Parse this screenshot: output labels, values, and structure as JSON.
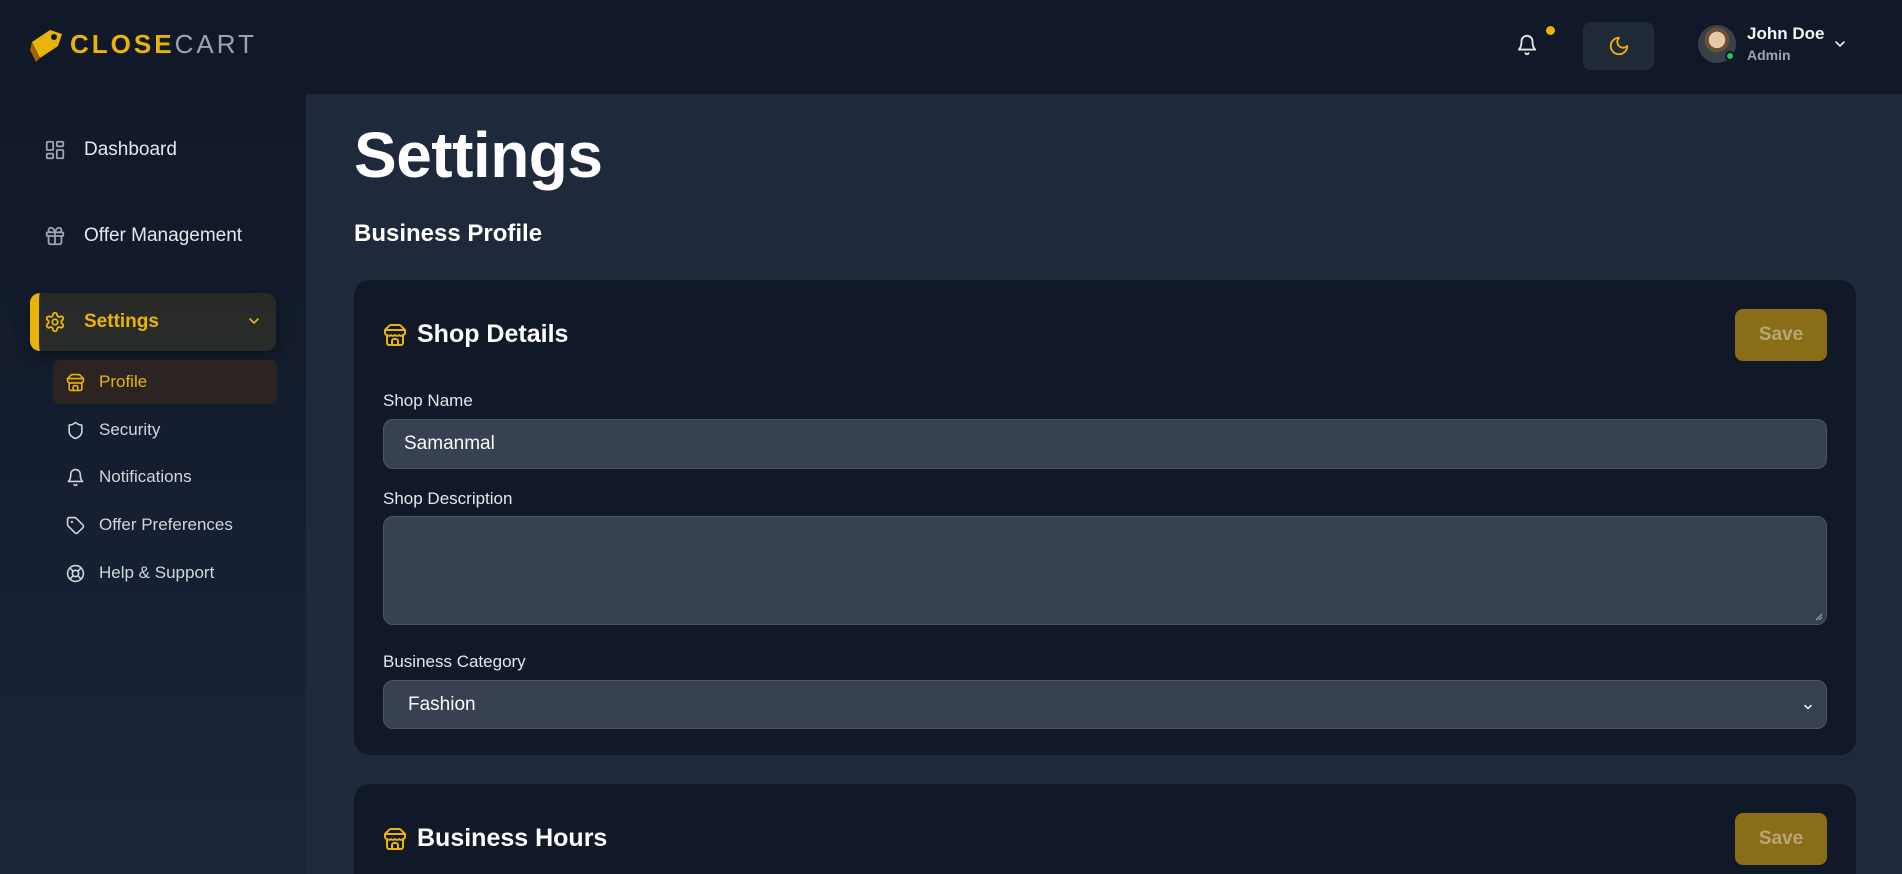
{
  "app": {
    "logo_close": "CLOSE",
    "logo_cart": "CART",
    "accent_color": "#eab308"
  },
  "header": {
    "bell_icon": "bell-icon",
    "theme_icon": "moon-icon",
    "user": {
      "name": "John Doe",
      "role": "Admin"
    }
  },
  "sidebar": {
    "items": [
      {
        "label": "Dashboard",
        "icon": "grid-icon"
      },
      {
        "label": "Offer Management",
        "icon": "gift-icon"
      },
      {
        "label": "Settings",
        "icon": "gear-icon",
        "active": true,
        "expanded": true
      }
    ],
    "settings_sub": [
      {
        "label": "Profile",
        "icon": "store-icon",
        "active": true
      },
      {
        "label": "Security",
        "icon": "shield-icon"
      },
      {
        "label": "Notifications",
        "icon": "bell-icon"
      },
      {
        "label": "Offer Preferences",
        "icon": "tag-icon"
      },
      {
        "label": "Help & Support",
        "icon": "lifebuoy-icon"
      }
    ]
  },
  "main": {
    "page_title": "Settings",
    "section_title": "Business Profile",
    "shop_details": {
      "title": "Shop Details",
      "save_label": "Save",
      "shop_name_label": "Shop Name",
      "shop_name_value": "Samanmal",
      "shop_description_label": "Shop Description",
      "shop_description_value": "",
      "business_category_label": "Business Category",
      "business_category_value": "Fashion"
    },
    "business_hours": {
      "title": "Business Hours",
      "save_label": "Save"
    }
  }
}
